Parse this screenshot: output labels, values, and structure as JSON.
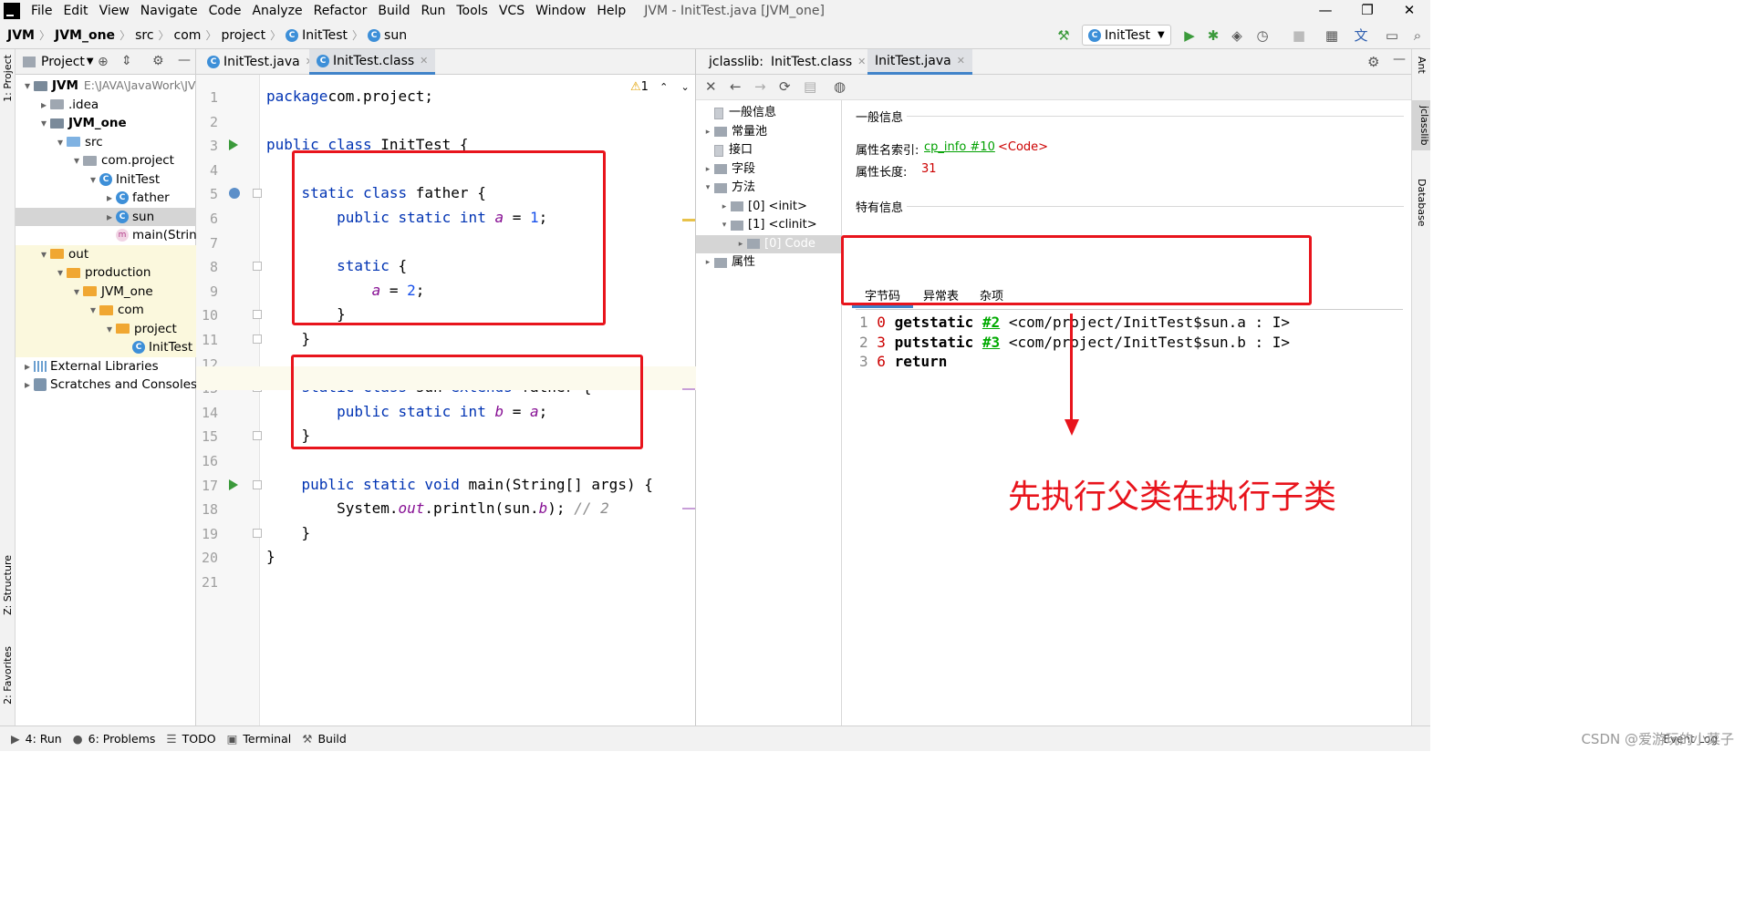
{
  "menu": {
    "items": [
      "File",
      "Edit",
      "View",
      "Navigate",
      "Code",
      "Analyze",
      "Refactor",
      "Build",
      "Run",
      "Tools",
      "VCS",
      "Window",
      "Help"
    ],
    "window_title": "JVM - InitTest.java [JVM_one]",
    "minimize": "—",
    "restore": "❐",
    "close": "✕"
  },
  "nav": {
    "crumbs": [
      "JVM",
      "JVM_one",
      "src",
      "com",
      "project",
      "InitTest",
      "sun"
    ],
    "run_config": "InitTest",
    "toolbar_icons": [
      "hammer-icon",
      "run-icon",
      "debug-icon",
      "coverage-icon",
      "profile-icon",
      "stop-icon",
      "project-structure-icon",
      "translate-icon",
      "layout-icon",
      "search-icon"
    ]
  },
  "left_stripe": {
    "project_label": "1: Project",
    "structure_label": "Z: Structure",
    "favorites_label": "2: Favorites"
  },
  "right_stripe": {
    "ant_label": "Ant",
    "jclasslib_label": "jclasslib",
    "database_label": "Database"
  },
  "project": {
    "header": "Project",
    "tree": [
      {
        "label": "JVM",
        "extra": "E:\\JAVA\\JavaWork\\JV",
        "depth": 0,
        "arrow": "open",
        "icon": "module",
        "bold": true
      },
      {
        "label": ".idea",
        "depth": 1,
        "arrow": "closed",
        "icon": "folder-grey"
      },
      {
        "label": "JVM_one",
        "depth": 1,
        "arrow": "open",
        "icon": "module",
        "bold": true
      },
      {
        "label": "src",
        "depth": 2,
        "arrow": "open",
        "icon": "folder-blue"
      },
      {
        "label": "com.project",
        "depth": 3,
        "arrow": "open",
        "icon": "package"
      },
      {
        "label": "InitTest",
        "depth": 4,
        "arrow": "open",
        "icon": "class"
      },
      {
        "label": "father",
        "depth": 5,
        "arrow": "closed",
        "icon": "class"
      },
      {
        "label": "sun",
        "depth": 5,
        "arrow": "closed",
        "icon": "class",
        "selected": true
      },
      {
        "label": "main(Strin",
        "depth": 5,
        "arrow": "none",
        "icon": "method"
      },
      {
        "label": "out",
        "depth": 1,
        "arrow": "open",
        "icon": "folder-orange",
        "excluded": true
      },
      {
        "label": "production",
        "depth": 2,
        "arrow": "open",
        "icon": "folder-orange",
        "excluded": true
      },
      {
        "label": "JVM_one",
        "depth": 3,
        "arrow": "open",
        "icon": "folder-orange",
        "excluded": true
      },
      {
        "label": "com",
        "depth": 4,
        "arrow": "open",
        "icon": "folder-orange",
        "excluded": true
      },
      {
        "label": "project",
        "depth": 5,
        "arrow": "open",
        "icon": "folder-orange",
        "excluded": true
      },
      {
        "label": "InitTest",
        "depth": 6,
        "arrow": "none",
        "icon": "class",
        "excluded": true
      },
      {
        "label": "External Libraries",
        "depth": 0,
        "arrow": "closed",
        "icon": "library"
      },
      {
        "label": "Scratches and Consoles",
        "depth": 0,
        "arrow": "closed",
        "icon": "scratch"
      }
    ]
  },
  "editor": {
    "tabs": [
      {
        "label": "InitTest.java",
        "active": false
      },
      {
        "label": "InitTest.class",
        "active": true
      }
    ],
    "warning_count": "1",
    "lines": [
      {
        "n": "1",
        "tokens": [
          [
            "kw",
            "package"
          ],
          [
            "",
            "com.project;"
          ]
        ]
      },
      {
        "n": "2",
        "tokens": []
      },
      {
        "n": "3",
        "tokens": [
          [
            "kw",
            "public class"
          ],
          [
            "",
            " InitTest {"
          ]
        ]
      },
      {
        "n": "4",
        "tokens": []
      },
      {
        "n": "5",
        "tokens": [
          [
            "",
            "    "
          ],
          [
            "kw",
            "static class"
          ],
          [
            "",
            " father {"
          ]
        ]
      },
      {
        "n": "6",
        "tokens": [
          [
            "",
            "        "
          ],
          [
            "kw",
            "public static int"
          ],
          [
            "",
            " "
          ],
          [
            "fld",
            "a"
          ],
          [
            "",
            " = "
          ],
          [
            "num",
            "1"
          ],
          [
            "",
            ";"
          ]
        ]
      },
      {
        "n": "7",
        "tokens": []
      },
      {
        "n": "8",
        "tokens": [
          [
            "",
            "        "
          ],
          [
            "kw",
            "static"
          ],
          [
            "",
            " {"
          ]
        ]
      },
      {
        "n": "9",
        "tokens": [
          [
            "",
            "            "
          ],
          [
            "fld",
            "a"
          ],
          [
            "",
            " = "
          ],
          [
            "num",
            "2"
          ],
          [
            "",
            ";"
          ]
        ]
      },
      {
        "n": "10",
        "tokens": [
          [
            "",
            "        }"
          ]
        ]
      },
      {
        "n": "11",
        "tokens": [
          [
            "",
            "    }"
          ]
        ]
      },
      {
        "n": "12",
        "tokens": []
      },
      {
        "n": "13",
        "tokens": [
          [
            "",
            "    "
          ],
          [
            "kw",
            "static class"
          ],
          [
            "",
            " sun "
          ],
          [
            "kw",
            "extends"
          ],
          [
            "",
            " father {"
          ]
        ]
      },
      {
        "n": "14",
        "tokens": [
          [
            "",
            "        "
          ],
          [
            "kw",
            "public static int"
          ],
          [
            "",
            " "
          ],
          [
            "fld",
            "b"
          ],
          [
            "",
            " = "
          ],
          [
            "fld",
            "a"
          ],
          [
            "",
            ";"
          ]
        ]
      },
      {
        "n": "15",
        "tokens": [
          [
            "",
            "    }"
          ]
        ]
      },
      {
        "n": "16",
        "tokens": []
      },
      {
        "n": "17",
        "tokens": [
          [
            "",
            "    "
          ],
          [
            "kw",
            "public static void"
          ],
          [
            "",
            " main(String[] args) {"
          ]
        ]
      },
      {
        "n": "18",
        "tokens": [
          [
            "",
            "        System."
          ],
          [
            "fld",
            "out"
          ],
          [
            "",
            ".println(sun."
          ],
          [
            "fld",
            "b"
          ],
          [
            "",
            "); "
          ],
          [
            "cmt",
            "// 2"
          ]
        ]
      },
      {
        "n": "19",
        "tokens": [
          [
            "",
            "    }"
          ]
        ]
      },
      {
        "n": "20",
        "tokens": [
          [
            "",
            "}"
          ]
        ]
      },
      {
        "n": "21",
        "tokens": []
      }
    ]
  },
  "jclasslib": {
    "tabs": [
      {
        "label": "jclasslib:",
        "active": false
      },
      {
        "label": "InitTest.class",
        "active": false
      },
      {
        "label": "InitTest.java",
        "active": true
      }
    ],
    "tool_icons": [
      "close-icon",
      "back-icon",
      "forward-icon",
      "refresh-icon",
      "save-icon",
      "web-icon"
    ],
    "tree": [
      {
        "label": "一般信息",
        "depth": 0,
        "arrow": "none",
        "icon": "doc"
      },
      {
        "label": "常量池",
        "depth": 0,
        "arrow": "closed",
        "icon": "folder"
      },
      {
        "label": "接口",
        "depth": 0,
        "arrow": "none",
        "icon": "doc"
      },
      {
        "label": "字段",
        "depth": 0,
        "arrow": "closed",
        "icon": "folder"
      },
      {
        "label": "方法",
        "depth": 0,
        "arrow": "open",
        "icon": "folder"
      },
      {
        "label": "[0] <init>",
        "depth": 1,
        "arrow": "closed",
        "icon": "folder"
      },
      {
        "label": "[1] <clinit>",
        "depth": 1,
        "arrow": "open",
        "icon": "folder"
      },
      {
        "label": "[0] Code",
        "depth": 2,
        "arrow": "closed",
        "icon": "folder",
        "selected": true
      },
      {
        "label": "属性",
        "depth": 0,
        "arrow": "closed",
        "icon": "folder"
      }
    ],
    "general_title": "一般信息",
    "attr_name_label": "属性名索引:",
    "attr_name_link": "cp_info #10",
    "attr_name_value": "<Code>",
    "attr_len_label": "属性长度:",
    "attr_len_value": "31",
    "specific_title": "特有信息",
    "subtabs": [
      "字节码",
      "异常表",
      "杂项"
    ],
    "bytecode": [
      {
        "idx": "1",
        "off": "0",
        "op": "getstatic",
        "ref": "#2",
        "arg": "<com/project/InitTest$sun.a : I>"
      },
      {
        "idx": "2",
        "off": "3",
        "op": "putstatic",
        "ref": "#3",
        "arg": "<com/project/InitTest$sun.b : I>"
      },
      {
        "idx": "3",
        "off": "6",
        "op": "return",
        "ref": "",
        "arg": ""
      }
    ]
  },
  "annotation": "先执行父类在执行子类",
  "statusbar": {
    "items": [
      {
        "glyph": "▶",
        "label": "4: Run",
        "name": "run-tool-button"
      },
      {
        "glyph": "●",
        "label": "6: Problems",
        "name": "problems-tool-button"
      },
      {
        "glyph": "☰",
        "label": "TODO",
        "name": "todo-tool-button"
      },
      {
        "glyph": "▣",
        "label": "Terminal",
        "name": "terminal-tool-button"
      },
      {
        "glyph": "⚒",
        "label": "Build",
        "name": "build-tool-button"
      }
    ],
    "event_log": "Event Log",
    "watermark": "CSDN @爱游玩的小菜子"
  },
  "colors": {
    "annotation_red": "#e8141c",
    "keyword": "#0033b3",
    "field": "#871094",
    "number": "#1750eb",
    "link_green": "#00a000"
  }
}
